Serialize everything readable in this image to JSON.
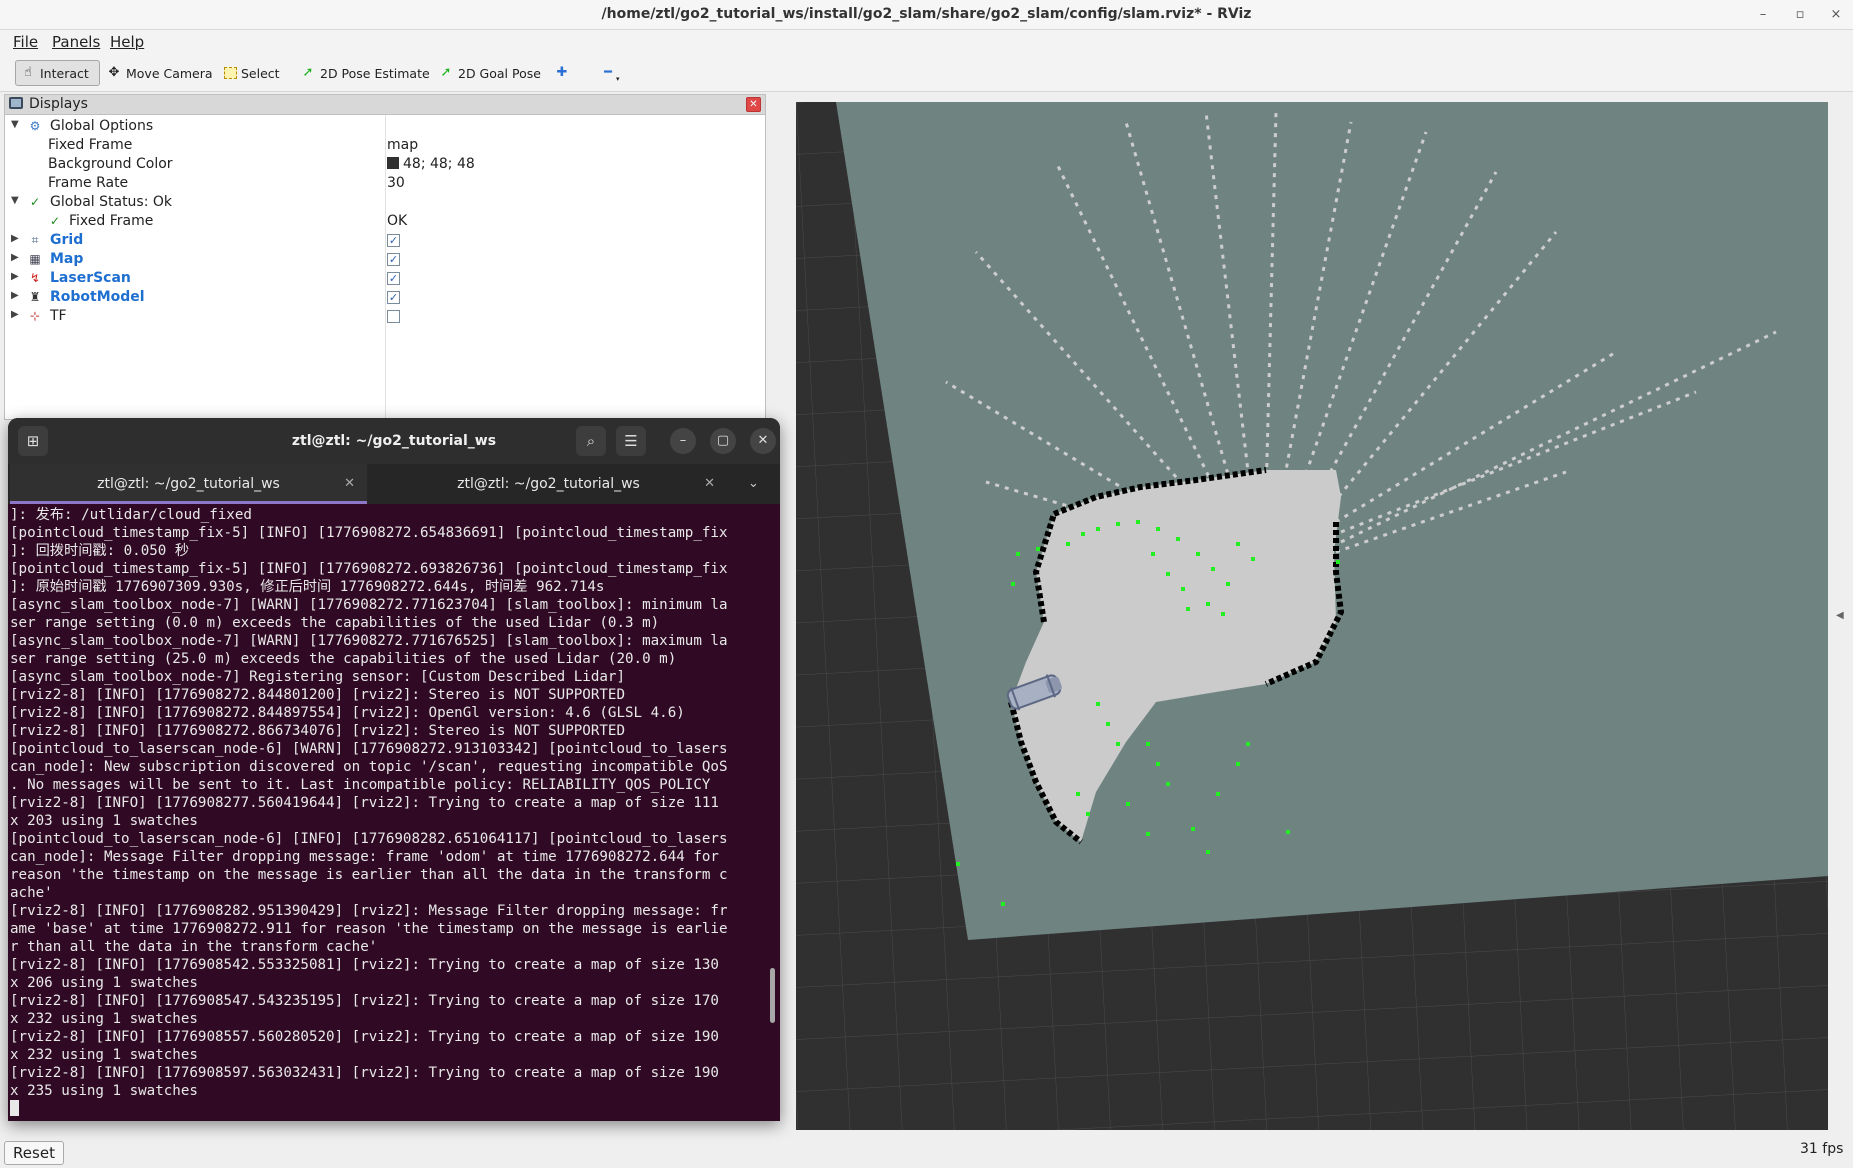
{
  "window": {
    "title": "/home/ztl/go2_tutorial_ws/install/go2_slam/share/go2_slam/config/slam.rviz* - RViz",
    "controls": [
      "–",
      "▫",
      "×"
    ]
  },
  "menubar": {
    "items": [
      "File",
      "Panels",
      "Help"
    ]
  },
  "toolbar": {
    "interact": "Interact",
    "move_camera": "Move Camera",
    "select": "Select",
    "pose_estimate": "2D Pose Estimate",
    "goal_pose": "2D Goal Pose"
  },
  "displays": {
    "title": "Displays",
    "global_options": "Global Options",
    "fixed_frame_label": "Fixed Frame",
    "fixed_frame_value": "map",
    "background_color_label": "Background Color",
    "background_color_value": "48; 48; 48",
    "frame_rate_label": "Frame Rate",
    "frame_rate_value": "30",
    "global_status": "Global Status: Ok",
    "status_fixed_frame_label": "Fixed Frame",
    "status_fixed_frame_value": "OK",
    "items": [
      {
        "label": "Grid",
        "checked": true,
        "icon": "grid-icon"
      },
      {
        "label": "Map",
        "checked": true,
        "icon": "map-icon"
      },
      {
        "label": "LaserScan",
        "checked": true,
        "icon": "laserscan-icon"
      },
      {
        "label": "RobotModel",
        "checked": true,
        "icon": "robot-icon"
      },
      {
        "label": "TF",
        "checked": false,
        "icon": "tf-icon"
      }
    ]
  },
  "viewport": {
    "background": "#303030",
    "map_free": "#cbcbcb",
    "map_unknown": "#6f8480",
    "map_occupied": "#000000",
    "scan": "#22ee22"
  },
  "status": {
    "reset": "Reset",
    "fps": "31 fps"
  },
  "terminal": {
    "title": "ztl@ztl: ~/go2_tutorial_ws",
    "tabs": [
      "ztl@ztl: ~/go2_tutorial_ws",
      "ztl@ztl: ~/go2_tutorial_ws"
    ],
    "lines": [
      "]: 发布: /utlidar/cloud_fixed",
      "[pointcloud_timestamp_fix-5] [INFO] [1776908272.654836691] [pointcloud_timestamp_fix",
      "]: 回拨时间戳: 0.050 秒",
      "[pointcloud_timestamp_fix-5] [INFO] [1776908272.693826736] [pointcloud_timestamp_fix",
      "]: 原始时间戳 1776907309.930s, 修正后时间 1776908272.644s, 时间差 962.714s",
      "[async_slam_toolbox_node-7] [WARN] [1776908272.771623704] [slam_toolbox]: minimum la",
      "ser range setting (0.0 m) exceeds the capabilities of the used Lidar (0.3 m)",
      "[async_slam_toolbox_node-7] [WARN] [1776908272.771676525] [slam_toolbox]: maximum la",
      "ser range setting (25.0 m) exceeds the capabilities of the used Lidar (20.0 m)",
      "[async_slam_toolbox_node-7] Registering sensor: [Custom Described Lidar]",
      "[rviz2-8] [INFO] [1776908272.844801200] [rviz2]: Stereo is NOT SUPPORTED",
      "[rviz2-8] [INFO] [1776908272.844897554] [rviz2]: OpenGl version: 4.6 (GLSL 4.6)",
      "[rviz2-8] [INFO] [1776908272.866734076] [rviz2]: Stereo is NOT SUPPORTED",
      "[pointcloud_to_laserscan_node-6] [WARN] [1776908272.913103342] [pointcloud_to_lasers",
      "can_node]: New subscription discovered on topic '/scan', requesting incompatible QoS",
      ". No messages will be sent to it. Last incompatible policy: RELIABILITY_QOS_POLICY",
      "[rviz2-8] [INFO] [1776908277.560419644] [rviz2]: Trying to create a map of size 111",
      "x 203 using 1 swatches",
      "[pointcloud_to_laserscan_node-6] [INFO] [1776908282.651064117] [pointcloud_to_lasers",
      "can_node]: Message Filter dropping message: frame 'odom' at time 1776908272.644 for",
      "reason 'the timestamp on the message is earlier than all the data in the transform c",
      "ache'",
      "[rviz2-8] [INFO] [1776908282.951390429] [rviz2]: Message Filter dropping message: fr",
      "ame 'base' at time 1776908272.911 for reason 'the timestamp on the message is earlie",
      "r than all the data in the transform cache'",
      "[rviz2-8] [INFO] [1776908542.553325081] [rviz2]: Trying to create a map of size 130",
      "x 206 using 1 swatches",
      "[rviz2-8] [INFO] [1776908547.543235195] [rviz2]: Trying to create a map of size 170",
      "x 232 using 1 swatches",
      "[rviz2-8] [INFO] [1776908557.560280520] [rviz2]: Trying to create a map of size 190",
      "x 232 using 1 swatches",
      "[rviz2-8] [INFO] [1776908597.563032431] [rviz2]: Trying to create a map of size 190",
      "x 235 using 1 swatches"
    ]
  }
}
